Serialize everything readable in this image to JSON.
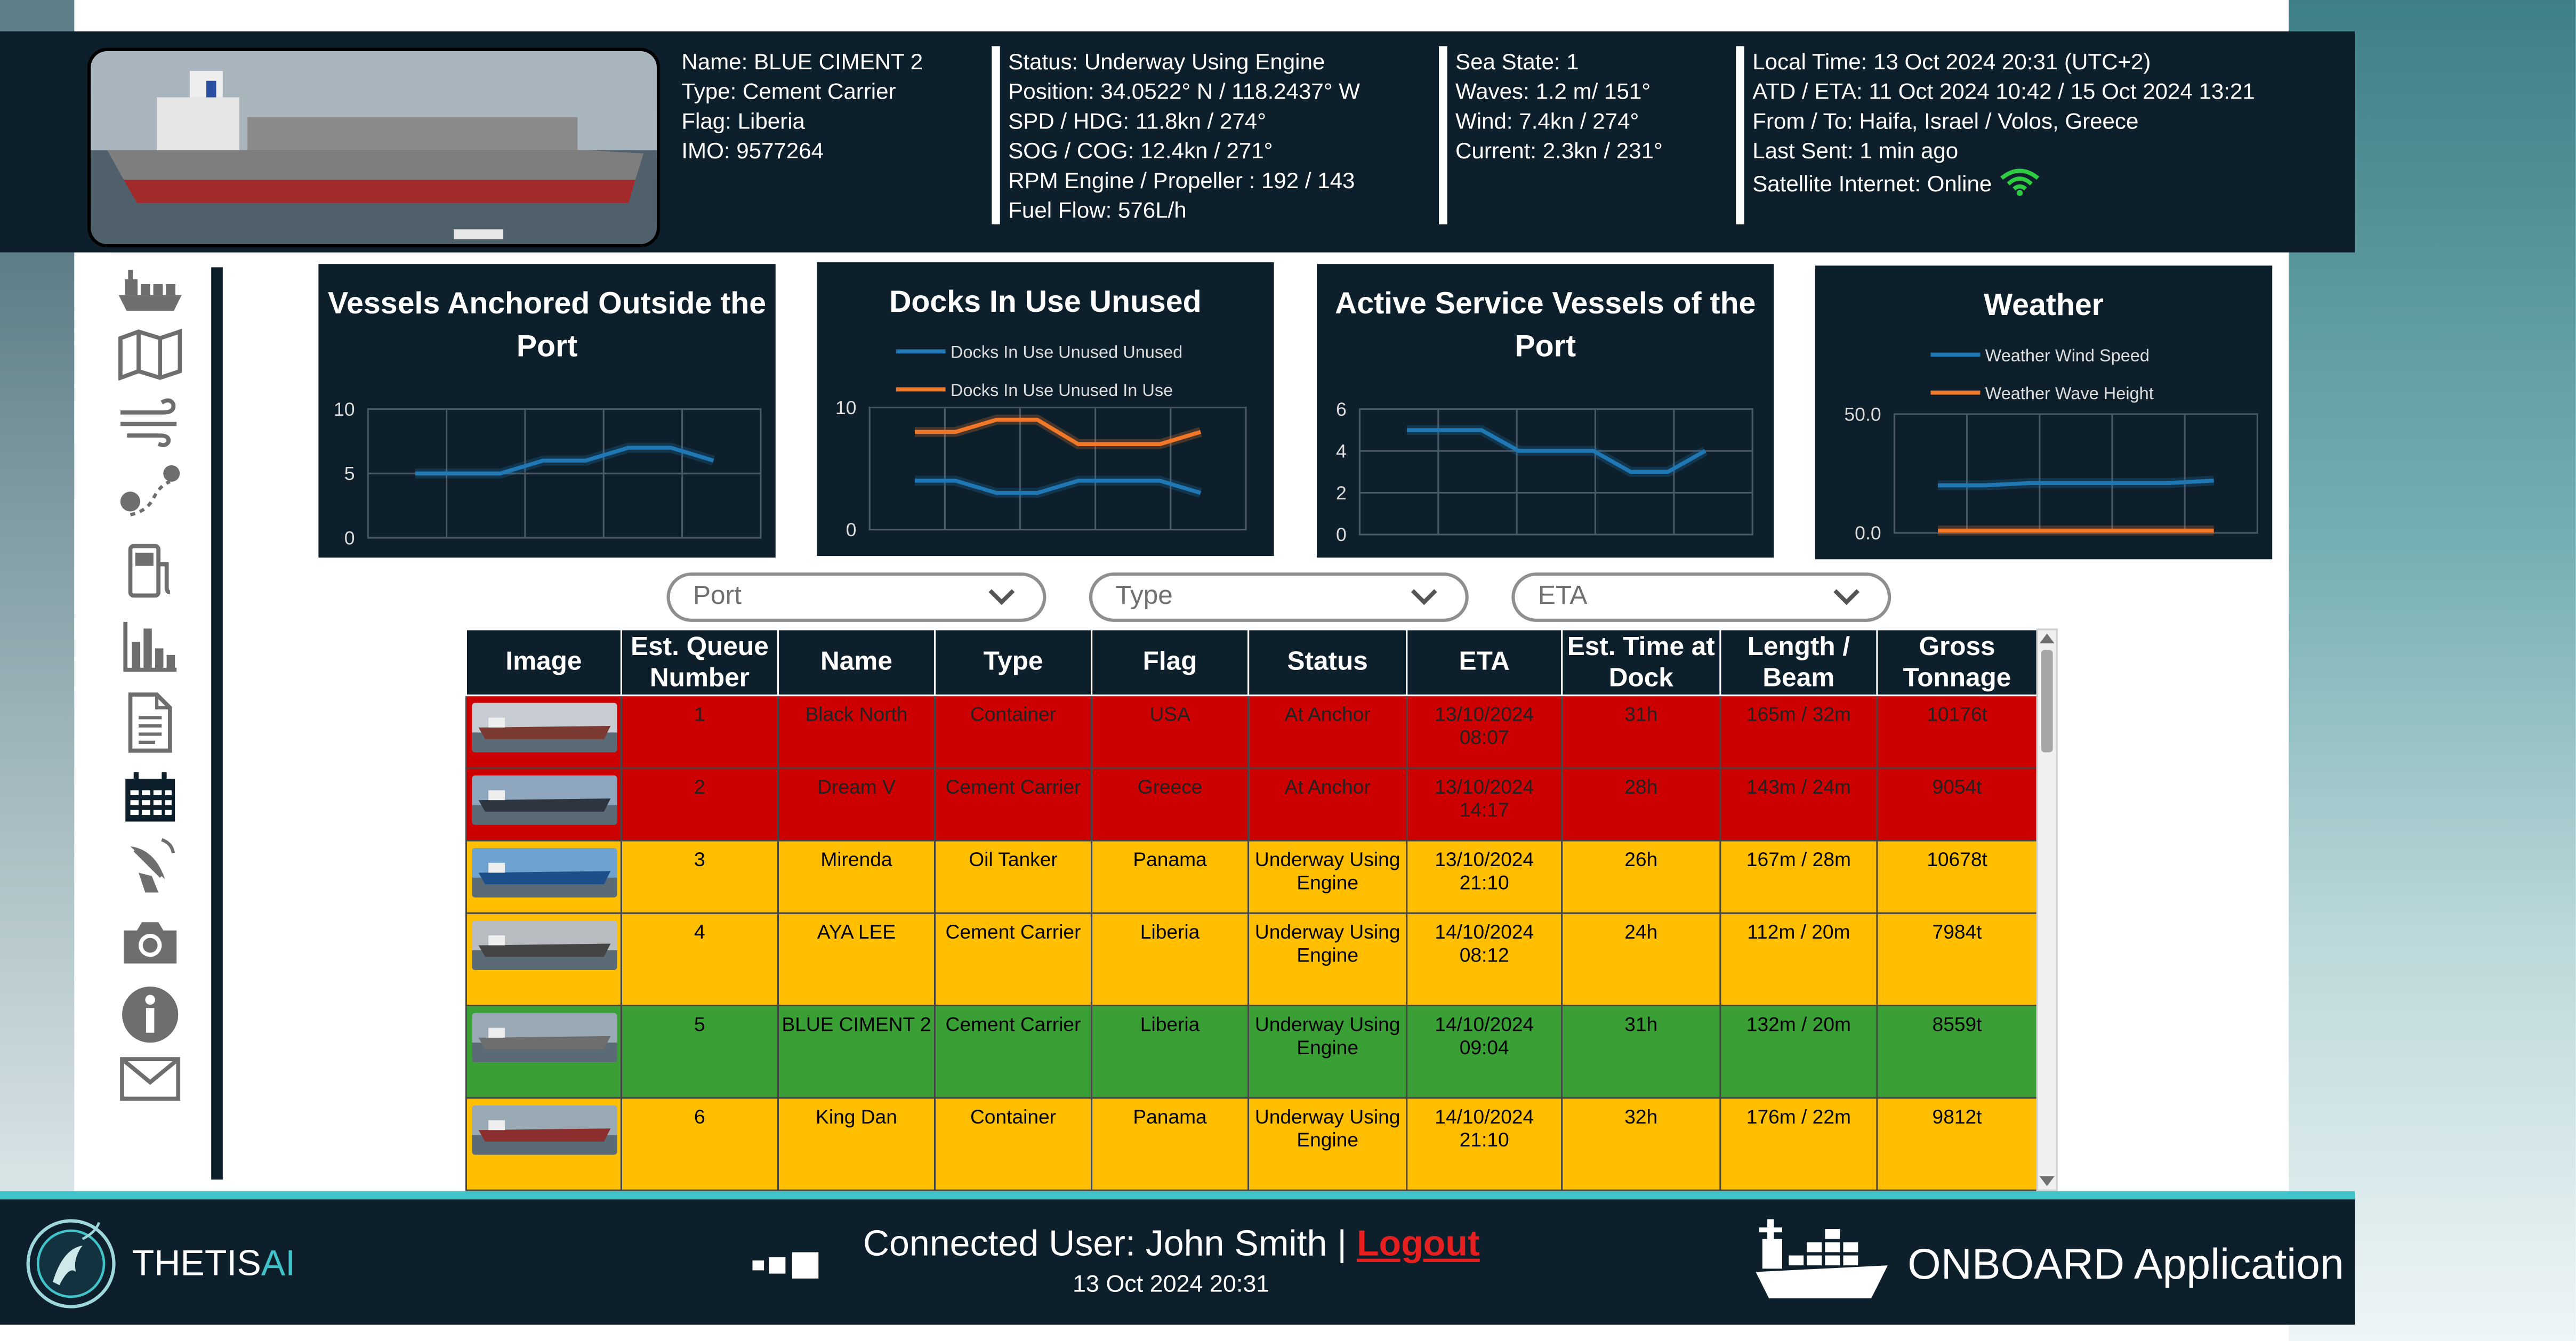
{
  "vessel": {
    "name": "Name: BLUE CIMENT 2",
    "type": "Type: Cement Carrier",
    "flag": "Flag: Liberia",
    "imo": "IMO: 9577264"
  },
  "navigation": {
    "status": "Status: Underway Using Engine",
    "position": "Position: 34.0522° N / 118.2437° W",
    "spd_hdg": "SPD / HDG: 11.8kn / 274°",
    "sog_cog": "SOG / COG: 12.4kn / 271°",
    "rpm": "RPM Engine / Propeller : 192 / 143",
    "fuel": "Fuel Flow: 576L/h"
  },
  "sea": {
    "state": "Sea State: 1",
    "waves": "Waves: 1.2 m/ 151°",
    "wind": "Wind: 7.4kn / 274°",
    "current": "Current: 2.3kn / 231°"
  },
  "voyage": {
    "local_time": "Local Time: 13 Oct 2024 20:31 (UTC+2)",
    "atd_eta": "ATD / ETA: 11 Oct 2024 10:42  / 15 Oct 2024 13:21",
    "from_to": "From / To: Haifa, Israel / Volos, Greece",
    "last_sent": "Last Sent: 1 min ago",
    "internet": "Satellite Internet: Online"
  },
  "nav_icons": [
    "ship-icon",
    "map-icon",
    "wind-icon",
    "route-icon",
    "fuel-icon",
    "bar-chart-icon",
    "document-icon",
    "calendar-icon",
    "satellite-icon",
    "camera-icon",
    "info-icon",
    "mail-icon"
  ],
  "chart_data": [
    {
      "type": "line",
      "title": "Vessels Anchored Outside the Port",
      "ylim": [
        0,
        10
      ],
      "yticks": [
        "10",
        "5",
        "0"
      ],
      "series": [
        {
          "values": [
            5,
            5,
            5,
            6,
            6,
            7,
            7,
            6
          ],
          "color": "#1f77b4"
        }
      ]
    },
    {
      "type": "line",
      "title": "Docks In Use Unused",
      "ylim": [
        0,
        10
      ],
      "yticks": [
        "10",
        "0"
      ],
      "series": [
        {
          "name": "Docks In Use Unused Unused",
          "values": [
            4,
            4,
            3,
            3,
            4,
            4,
            4,
            3
          ],
          "color": "#1f77b4"
        },
        {
          "name": "Docks In Use Unused In Use",
          "values": [
            8,
            8,
            9,
            9,
            7,
            7,
            7,
            8
          ],
          "color": "#f07828"
        }
      ]
    },
    {
      "type": "line",
      "title": "Active Service Vessels of the Port",
      "ylim": [
        0,
        6
      ],
      "yticks": [
        "6",
        "4",
        "2",
        "0"
      ],
      "series": [
        {
          "values": [
            5,
            5,
            5,
            4,
            4,
            4,
            3,
            3,
            4
          ],
          "color": "#1f77b4"
        }
      ]
    },
    {
      "type": "line",
      "title": "Weather",
      "ylim": [
        0,
        50
      ],
      "yticks": [
        "50.0",
        "0.0"
      ],
      "series": [
        {
          "name": "Weather Wind Speed",
          "values": [
            20,
            20,
            21,
            21,
            21,
            21,
            22
          ],
          "color": "#1f77b4"
        },
        {
          "name": "Weather Wave Height",
          "values": [
            1,
            1,
            1,
            1,
            1,
            1,
            1
          ],
          "color": "#f07828"
        }
      ]
    }
  ],
  "filters": {
    "port": "Port",
    "type": "Type",
    "eta": "ETA"
  },
  "table": {
    "headers": [
      "Image",
      "Est. Queue Number",
      "Name",
      "Type",
      "Flag",
      "Status",
      "ETA",
      "Est. Time at Dock",
      "Length / Beam",
      "Gross Tonnage"
    ],
    "rows": [
      {
        "color": "red",
        "queue": "1",
        "name": "Black North",
        "type": "Container",
        "flag": "USA",
        "status": "At Anchor",
        "eta": "13/10/2024 08:07",
        "time": "31h",
        "dims": "165m / 32m",
        "tonnage": "10176t"
      },
      {
        "color": "red",
        "queue": "2",
        "name": "Dream V",
        "type": "Cement Carrier",
        "flag": "Greece",
        "status": "At Anchor",
        "eta": "13/10/2024 14:17",
        "time": "28h",
        "dims": "143m / 24m",
        "tonnage": "9054t"
      },
      {
        "color": "yellow",
        "queue": "3",
        "name": "Mirenda",
        "type": "Oil Tanker",
        "flag": "Panama",
        "status": "Underway Using Engine",
        "eta": "13/10/2024 21:10",
        "time": "26h",
        "dims": "167m / 28m",
        "tonnage": "10678t"
      },
      {
        "color": "yellow",
        "queue": "4",
        "name": "AYA LEE",
        "type": "Cement Carrier",
        "flag": "Liberia",
        "status": "Underway Using Engine",
        "eta": "14/10/2024 08:12",
        "time": "24h",
        "dims": "112m / 20m",
        "tonnage": "7984t"
      },
      {
        "color": "green",
        "queue": "5",
        "name": "BLUE CIMENT 2",
        "type": "Cement Carrier",
        "flag": "Liberia",
        "status": "Underway Using Engine",
        "eta": "14/10/2024 09:04",
        "time": "31h",
        "dims": "132m / 20m",
        "tonnage": "8559t"
      },
      {
        "color": "yellow",
        "queue": "6",
        "name": "King Dan",
        "type": "Container",
        "flag": "Panama",
        "status": "Underway Using Engine",
        "eta": "14/10/2024 21:10",
        "time": "32h",
        "dims": "176m / 22m",
        "tonnage": "9812t"
      }
    ]
  },
  "footer": {
    "brand": "THETIS",
    "brand_ai": "AI",
    "user": "Connected User: John Smith | ",
    "logout": "Logout",
    "datetime": "13 Oct 2024 20:31",
    "app": "ONBOARD Application"
  }
}
